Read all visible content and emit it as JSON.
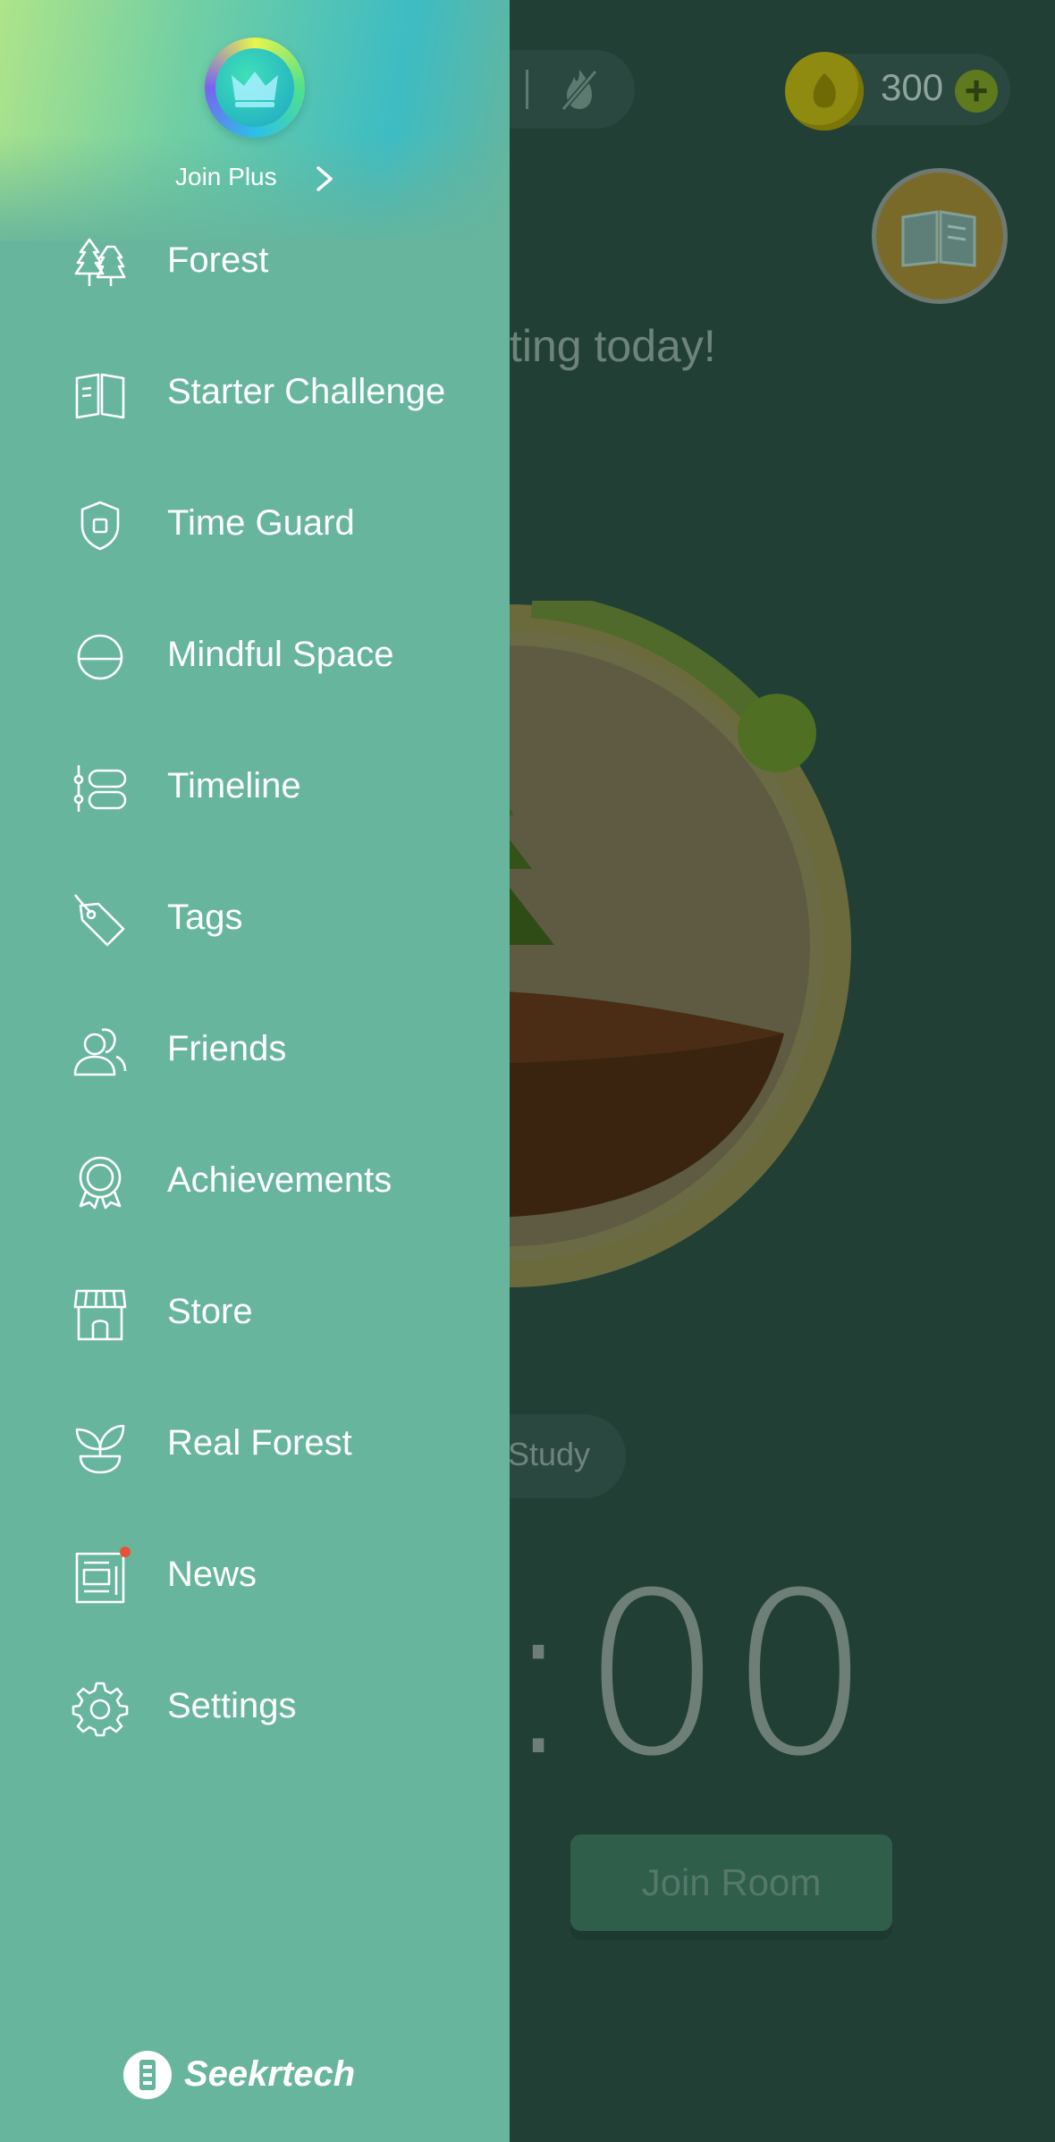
{
  "colors": {
    "drawer_bg": "#67b59c",
    "main_bg": "#223f36",
    "news_badge": "#e8503a"
  },
  "main": {
    "coins": "300",
    "motivation_partial": "ting today!",
    "tag_partial": "Study",
    "timer_partial": ":00",
    "join_room": "Join Room"
  },
  "drawer": {
    "join_plus": "Join Plus",
    "items": [
      {
        "label": "Forest",
        "icon": "forest-icon"
      },
      {
        "label": "Starter Challenge",
        "icon": "book-icon"
      },
      {
        "label": "Time Guard",
        "icon": "shield-icon"
      },
      {
        "label": "Mindful Space",
        "icon": "mindful-icon"
      },
      {
        "label": "Timeline",
        "icon": "timeline-icon"
      },
      {
        "label": "Tags",
        "icon": "tag-icon"
      },
      {
        "label": "Friends",
        "icon": "friends-icon"
      },
      {
        "label": "Achievements",
        "icon": "medal-icon"
      },
      {
        "label": "Store",
        "icon": "store-icon"
      },
      {
        "label": "Real Forest",
        "icon": "sprout-icon"
      },
      {
        "label": "News",
        "icon": "news-icon"
      },
      {
        "label": "Settings",
        "icon": "gear-icon"
      }
    ],
    "brand": "Seekrtech"
  }
}
